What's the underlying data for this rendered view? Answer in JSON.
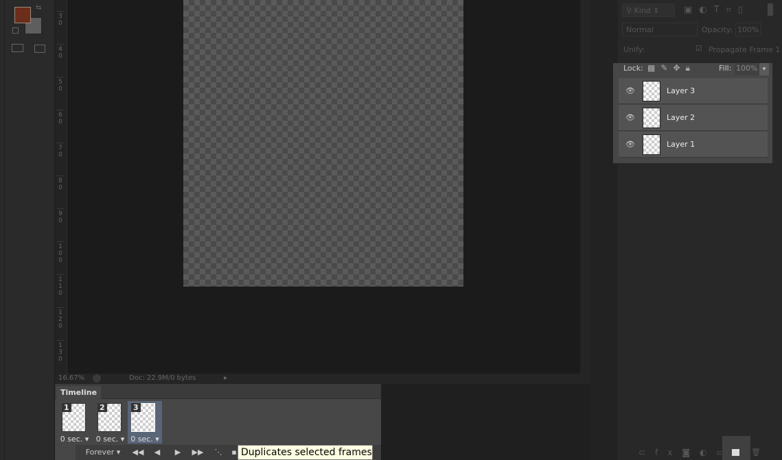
{
  "toolbar": {
    "foreground_color": "#6a2e1a",
    "background_color": "#5e5e5e"
  },
  "ruler": {
    "labels": [
      "30",
      "40",
      "50",
      "60",
      "70",
      "80",
      "90",
      "100",
      "110",
      "120",
      "130"
    ]
  },
  "status": {
    "zoom": "16.67%",
    "doc": "Doc: 22.9M/0 bytes"
  },
  "timeline": {
    "title": "Timeline",
    "frames": [
      {
        "num": "1",
        "delay": "0 sec."
      },
      {
        "num": "2",
        "delay": "0 sec."
      },
      {
        "num": "3",
        "delay": "0 sec.",
        "selected": true
      }
    ],
    "loop": "Forever",
    "tooltip": "Duplicates selected frames"
  },
  "layers": {
    "filter_kind": "Kind",
    "blend_mode": "Normal",
    "opacity_label": "Opacity:",
    "opacity": "100%",
    "unify_label": "Unify:",
    "propagate": "Propagate Frame 1",
    "lock_label": "Lock:",
    "fill_label": "Fill:",
    "fill": "100%",
    "items": [
      {
        "name": "Layer 3"
      },
      {
        "name": "Layer 2"
      },
      {
        "name": "Layer 1"
      }
    ]
  }
}
